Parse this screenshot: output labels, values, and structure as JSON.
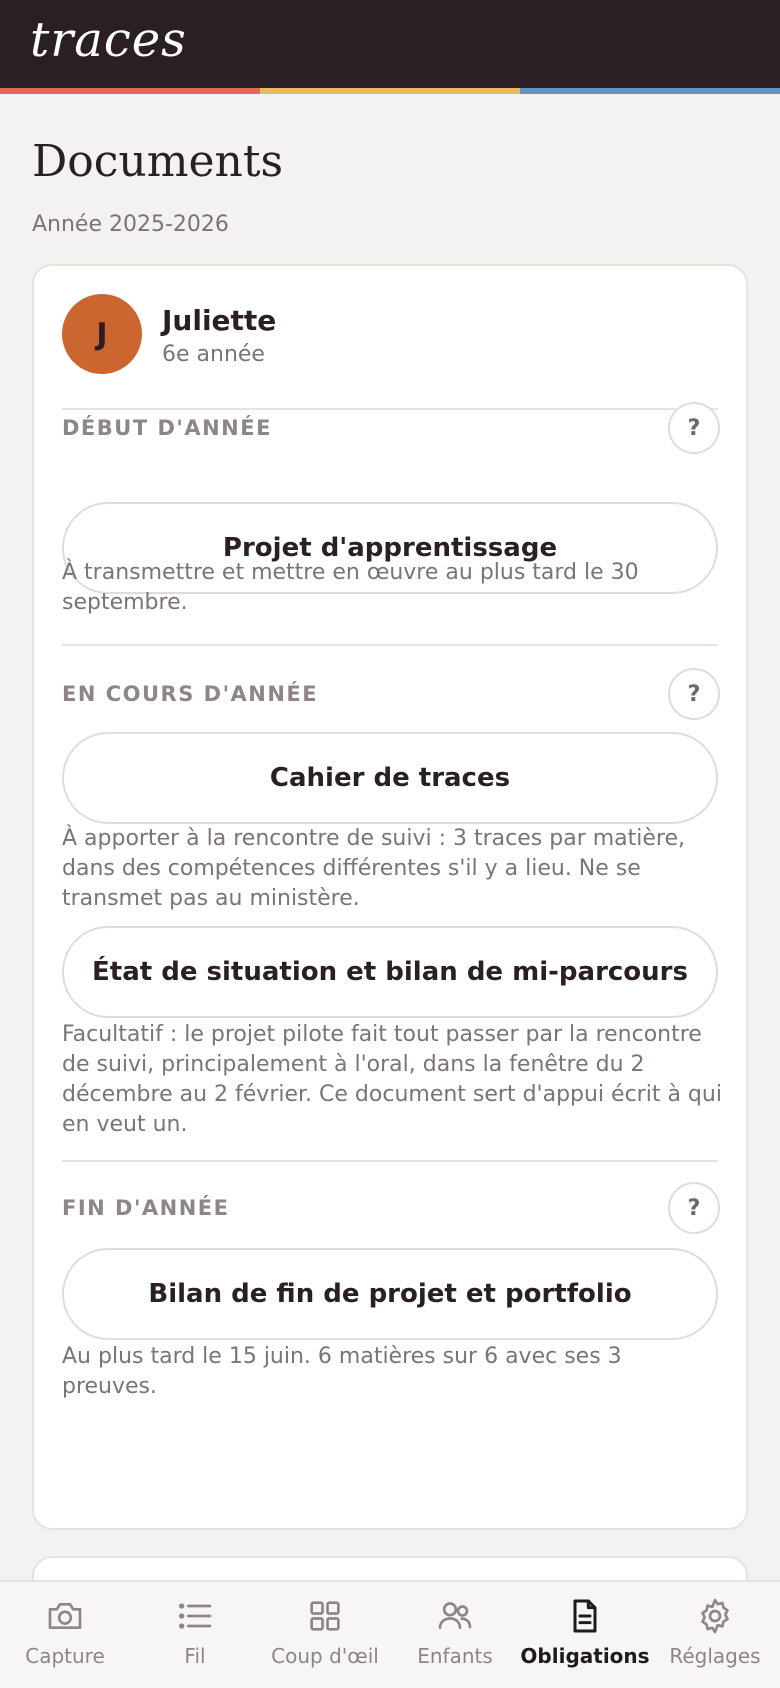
{
  "app": {
    "logo": "traces"
  },
  "page": {
    "title": "Documents",
    "subtitle": "Année 2025-2026"
  },
  "child": {
    "initial": "J",
    "name": "Juliette",
    "grade": "6e année"
  },
  "sections": [
    {
      "label": "DÉBUT D'ANNÉE",
      "help": "?",
      "documents": [
        {
          "label": "Projet d'apprentissage",
          "note": "À transmettre et mettre en œuvre au plus tard le 30 septembre."
        }
      ]
    },
    {
      "label": "EN COURS D'ANNÉE",
      "help": "?",
      "documents": [
        {
          "label": "Cahier de traces",
          "note": "À apporter à la rencontre de suivi : 3 traces par matière, dans des compétences différentes s'il y a lieu. Ne se transmet pas au ministère."
        },
        {
          "label": "État de situation et bilan de mi-parcours",
          "note": "Facultatif : le projet pilote fait tout passer par la rencontre de suivi, principalement à l'oral, dans la fenêtre du 2 décembre au 2 février. Ce document sert d'appui écrit à qui en veut un."
        }
      ]
    },
    {
      "label": "FIN D'ANNÉE",
      "help": "?",
      "documents": [
        {
          "label": "Bilan de fin de projet et portfolio",
          "note": "Au plus tard le 15 juin. 6 matières sur 6 avec ses 3 preuves."
        }
      ]
    }
  ],
  "nav": [
    {
      "label": "Capture",
      "icon": "camera-icon",
      "active": false
    },
    {
      "label": "Fil",
      "icon": "list-icon",
      "active": false
    },
    {
      "label": "Coup d'œil",
      "icon": "grid-icon",
      "active": false
    },
    {
      "label": "Enfants",
      "icon": "users-icon",
      "active": false
    },
    {
      "label": "Obligations",
      "icon": "document-icon",
      "active": true
    },
    {
      "label": "Réglages",
      "icon": "gear-icon",
      "active": false
    }
  ],
  "colors": {
    "header": "#2b1f26",
    "stripe_red": "#e8674f",
    "stripe_yellow": "#f2b65a",
    "stripe_blue": "#5a9bbd",
    "avatar": "#cc6631"
  }
}
